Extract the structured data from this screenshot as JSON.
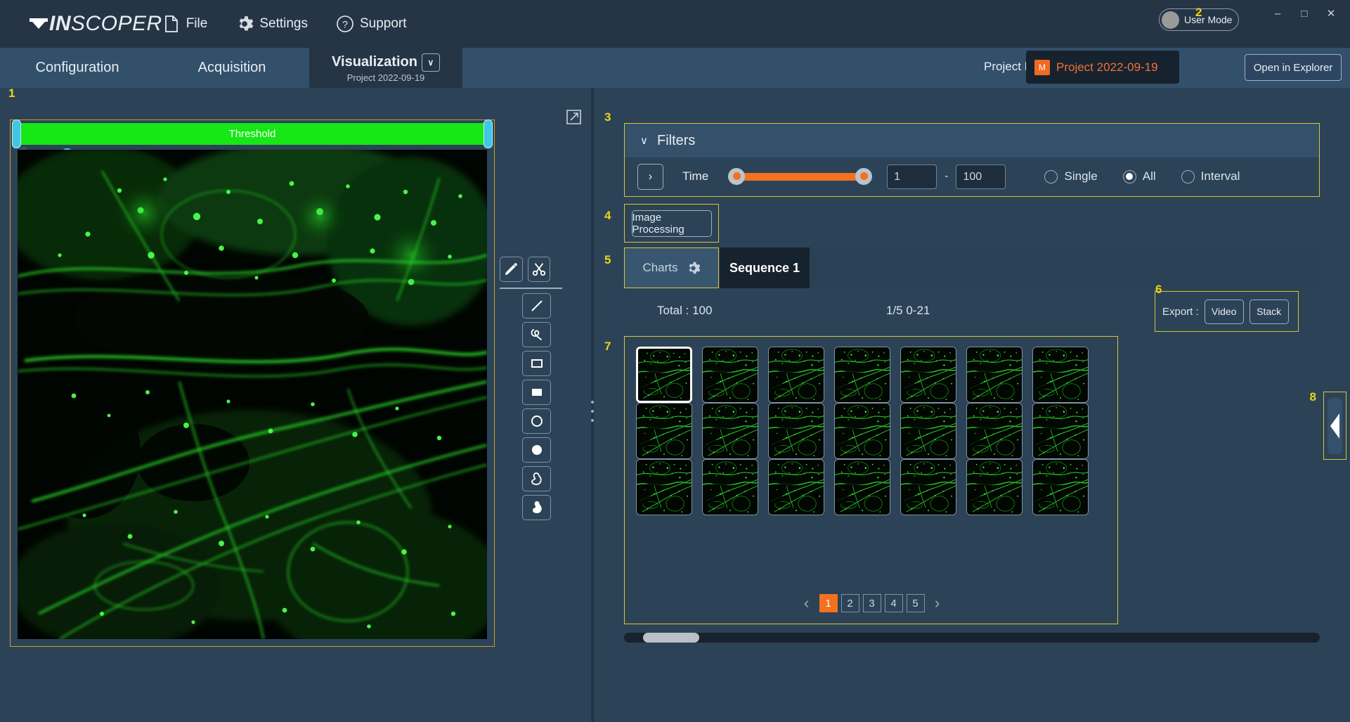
{
  "app": {
    "logo_prefix": "IN",
    "logo_suffix": "SCOPER"
  },
  "titlebar": {
    "menu": [
      {
        "label": "File",
        "icon": "file-icon"
      },
      {
        "label": "Settings",
        "icon": "gear-icon"
      },
      {
        "label": "Support",
        "icon": "question-circle-icon"
      }
    ],
    "user_mode_label": "User Mode",
    "window_controls": {
      "minimize": "–",
      "maximize": "□",
      "close": "✕"
    }
  },
  "tabs": {
    "configuration": "Configuration",
    "acquisition": "Acquisition",
    "visualization": "Visualization",
    "visualization_sub": "Project 2022-09-19",
    "chevron": "∨"
  },
  "project": {
    "label": "Project Name",
    "badge": "M",
    "name": "Project 2022-09-19",
    "open_explorer": "Open in Explorer"
  },
  "callouts": {
    "c1": "1",
    "c2": "2",
    "c3": "3",
    "c4": "4",
    "c5": "5",
    "c6": "6",
    "c7": "7",
    "c8": "8"
  },
  "viewer": {
    "threshold_label": "Threshold",
    "expand_icon": "expand-icon",
    "tools": [
      {
        "name": "pencil-icon"
      },
      {
        "name": "scissors-icon"
      },
      {
        "name": "line-icon"
      },
      {
        "name": "freehand-icon"
      },
      {
        "name": "rectangle-outline-icon"
      },
      {
        "name": "rectangle-filled-icon"
      },
      {
        "name": "circle-outline-icon"
      },
      {
        "name": "circle-filled-icon"
      },
      {
        "name": "blob-outline-icon"
      },
      {
        "name": "blob-filled-icon"
      }
    ]
  },
  "filters": {
    "title": "Filters",
    "collapse_chevron": "∨",
    "expand_arrow": "›",
    "time_label": "Time",
    "min_value": "1",
    "max_value": "100",
    "separator": "-",
    "modes": [
      {
        "label": "Single",
        "selected": false
      },
      {
        "label": "All",
        "selected": true
      },
      {
        "label": "Interval",
        "selected": false
      }
    ]
  },
  "image_processing": {
    "label": "Image Processing"
  },
  "content_tabs": {
    "charts": "Charts",
    "charts_icon": "gear-icon",
    "sequence": "Sequence 1"
  },
  "info": {
    "total": "Total : 100",
    "range": "1/5 0-21"
  },
  "export": {
    "label": "Export :",
    "video": "Video",
    "stack": "Stack"
  },
  "thumbnails": {
    "count": 21,
    "selected_index": 0
  },
  "pagination": {
    "prev": "‹",
    "next": "›",
    "pages": [
      "1",
      "2",
      "3",
      "4",
      "5"
    ],
    "active": "1"
  },
  "colors": {
    "accent_orange": "#f4711f",
    "callout_yellow": "#d8c63a",
    "panel_bg": "#2c4256",
    "titlebar_bg": "#253546",
    "tab_bg": "#33506b",
    "threshold_green": "#17e617",
    "project_orange": "#f0703a"
  }
}
